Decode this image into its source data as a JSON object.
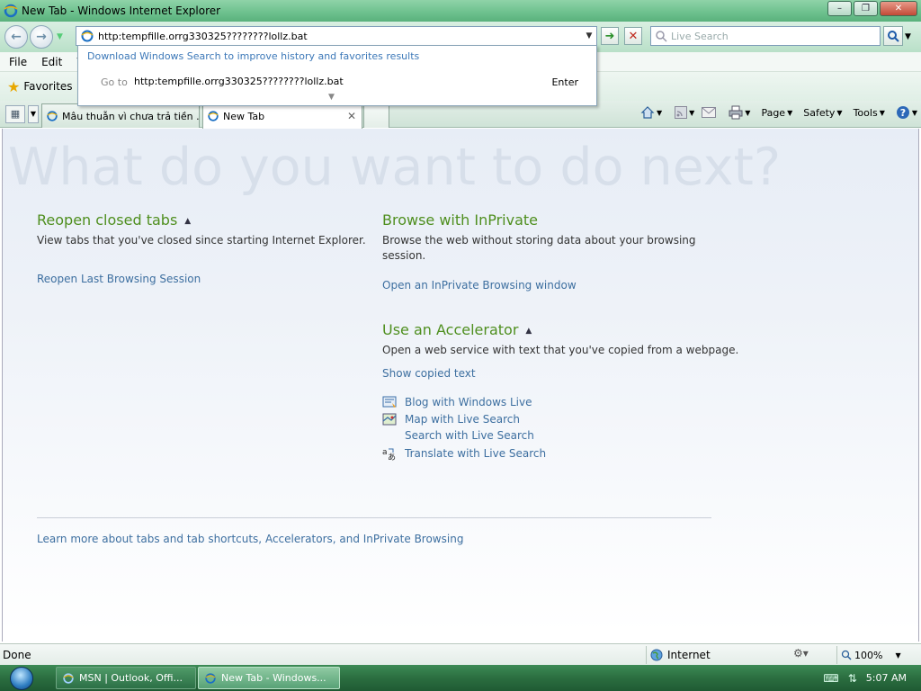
{
  "window": {
    "title": "New Tab - Windows Internet Explorer",
    "minimize": "–",
    "maximize": "❐",
    "close": "✕"
  },
  "address": {
    "value": "http:tempfille.orrg330325????????lollz.bat"
  },
  "search": {
    "placeholder": "Live Search"
  },
  "menu": {
    "items": [
      "File",
      "Edit",
      "V"
    ]
  },
  "favorites": {
    "label": "Favorites"
  },
  "tabs": [
    {
      "label": "Mâu thuẫn vì chưa trả tiền ..."
    },
    {
      "label": "New Tab"
    }
  ],
  "commandbar": {
    "page": "Page",
    "safety": "Safety",
    "tools": "Tools"
  },
  "popup": {
    "tip": "Download Windows Search to improve history and favorites results",
    "goto_label": "Go to",
    "goto_value": "http:tempfille.orrg330325????????lollz.bat",
    "enter": "Enter"
  },
  "content": {
    "hero": "What do you want to do next?",
    "reopen": {
      "title": "Reopen closed tabs",
      "desc": "View tabs that you've closed since starting Internet Explorer.",
      "link": "Reopen Last Browsing Session"
    },
    "inprivate": {
      "title": "Browse with InPrivate",
      "desc": "Browse the web without storing data about your browsing session.",
      "link": "Open an InPrivate Browsing window"
    },
    "accelerator": {
      "title": "Use an Accelerator",
      "desc": "Open a web service with text that you've copied from a webpage.",
      "link": "Show copied text",
      "items": [
        {
          "label": "Blog with Windows Live",
          "icon": "blog-icon"
        },
        {
          "label": "Map with Live Search",
          "icon": "map-icon"
        },
        {
          "label": "Search with Live Search",
          "icon": ""
        },
        {
          "label": "Translate with Live Search",
          "icon": "translate-icon"
        }
      ]
    },
    "footer_link": "Learn more about tabs and tab shortcuts, Accelerators, and InPrivate Browsing"
  },
  "status": {
    "text": "Done",
    "zone": "Internet",
    "zoom": "100%"
  },
  "taskbar": {
    "items": [
      {
        "label": "MSN | Outlook, Offi..."
      },
      {
        "label": "New Tab - Windows..."
      }
    ],
    "clock": "5:07 AM"
  },
  "colors": {
    "accent_green": "#4f8f1f",
    "link_blue": "#3d6fa0",
    "titlebar": "#6cc08d"
  }
}
